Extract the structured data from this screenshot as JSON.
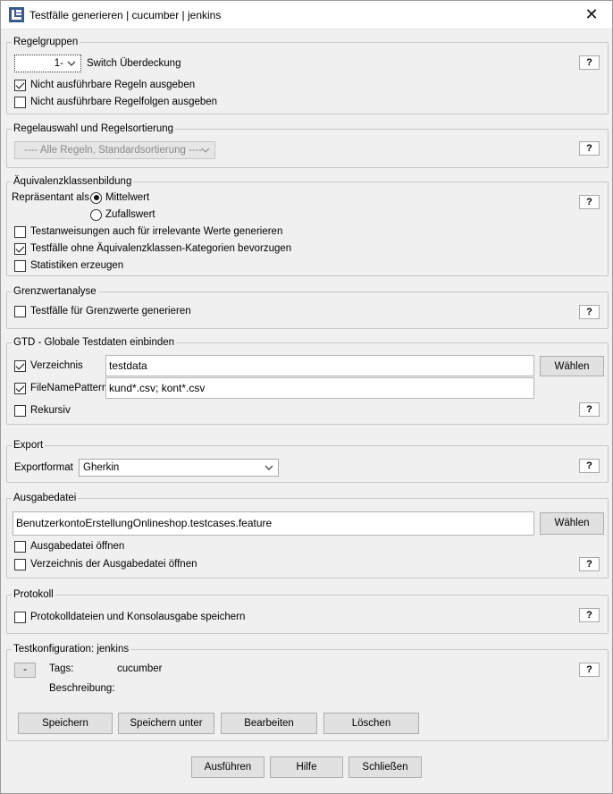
{
  "window": {
    "title": "Testfälle generieren | cucumber | jenkins",
    "close_icon": "close-icon"
  },
  "help_label": "?",
  "regelgruppen": {
    "title": "Regelgruppen",
    "combo_value": "1-",
    "combo_label": "Switch Überdeckung",
    "cb_nicht_ausfuehrbare_regeln": {
      "label": "Nicht ausführbare Regeln ausgeben",
      "checked": true
    },
    "cb_nicht_ausfuehrbare_regelfolgen": {
      "label": "Nicht ausführbare Regelfolgen ausgeben",
      "checked": false
    }
  },
  "regelauswahl": {
    "title": "Regelauswahl und Regelsortierung",
    "combo_value": "---- Alle Regeln, Standardsortierung ----"
  },
  "aequivalenz": {
    "title": "Äquivalenzklassenbildung",
    "repr_label": "Repräsentant als",
    "radio_mittelwert": {
      "label": "Mittelwert",
      "checked": true
    },
    "radio_zufallswert": {
      "label": "Zufallswert",
      "checked": false
    },
    "cb_irrelevante": {
      "label": "Testanweisungen auch für irrelevante Werte generieren",
      "checked": false
    },
    "cb_ohne_kategorien": {
      "label": "Testfälle ohne Äquivalenzklassen-Kategorien bevorzugen",
      "checked": true
    },
    "cb_statistiken": {
      "label": "Statistiken erzeugen",
      "checked": false
    }
  },
  "grenzwert": {
    "title": "Grenzwertanalyse",
    "cb_grenzwerte": {
      "label": "Testfälle für Grenzwerte generieren",
      "checked": false
    }
  },
  "gtd": {
    "title": "GTD - Globale Testdaten einbinden",
    "cb_verzeichnis": {
      "label": "Verzeichnis",
      "checked": true
    },
    "verzeichnis_value": "testdata",
    "waehlen_label": "Wählen",
    "cb_filenamepattern": {
      "label": "FileNamePattern",
      "checked": true
    },
    "pattern_value": "kund*.csv; kont*.csv",
    "cb_rekursiv": {
      "label": "Rekursiv",
      "checked": false
    }
  },
  "export": {
    "title": "Export",
    "format_label": "Exportformat",
    "format_value": "Gherkin"
  },
  "ausgabe": {
    "title": "Ausgabedatei",
    "file_value": "BenutzerkontoErstellungOnlineshop.testcases.feature",
    "waehlen_label": "Wählen",
    "cb_oeffnen": {
      "label": "Ausgabedatei öffnen",
      "checked": false
    },
    "cb_verzeichnis_oeffnen": {
      "label": "Verzeichnis der Ausgabedatei öffnen",
      "checked": false
    }
  },
  "protokoll": {
    "title": "Protokoll",
    "cb_speichern": {
      "label": "Protokolldateien und Konsolausgabe speichern",
      "checked": false
    }
  },
  "testkonfig": {
    "title": "Testkonfiguration: jenkins",
    "collapse_label": "-",
    "tags_label": "Tags:",
    "tags_value": "cucumber",
    "beschreibung_label": "Beschreibung:",
    "btn_speichern": "Speichern",
    "btn_speichern_unter": "Speichern unter",
    "btn_bearbeiten": "Bearbeiten",
    "btn_loeschen": "Löschen"
  },
  "footer": {
    "btn_ausfuehren": "Ausführen",
    "btn_hilfe": "Hilfe",
    "btn_schliessen": "Schließen"
  }
}
